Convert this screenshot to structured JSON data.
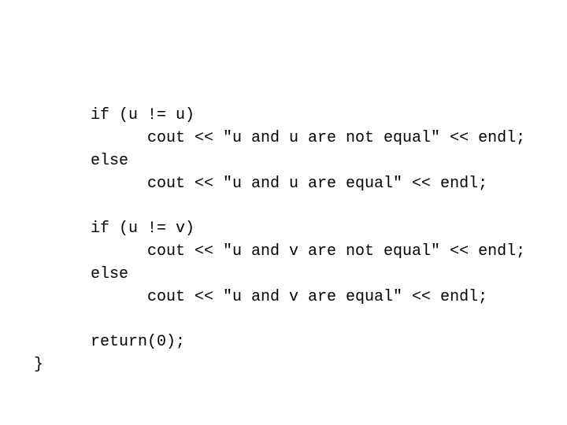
{
  "code_lines": [
    {
      "indent": 1,
      "text": "if (u != u)"
    },
    {
      "indent": 2,
      "text": "cout << \"u and u are not equal\" << endl;"
    },
    {
      "indent": 1,
      "text": "else"
    },
    {
      "indent": 2,
      "text": "cout << \"u and u are equal\" << endl;"
    },
    {
      "indent": 1,
      "text": "if (u != v)"
    },
    {
      "indent": 2,
      "text": "cout << \"u and v are not equal\" << endl;"
    },
    {
      "indent": 1,
      "text": "else"
    },
    {
      "indent": 2,
      "text": "cout << \"u and v are equal\" << endl;"
    },
    {
      "indent": 1,
      "text": "return(0);"
    },
    {
      "indent": 0,
      "text": "}"
    }
  ]
}
